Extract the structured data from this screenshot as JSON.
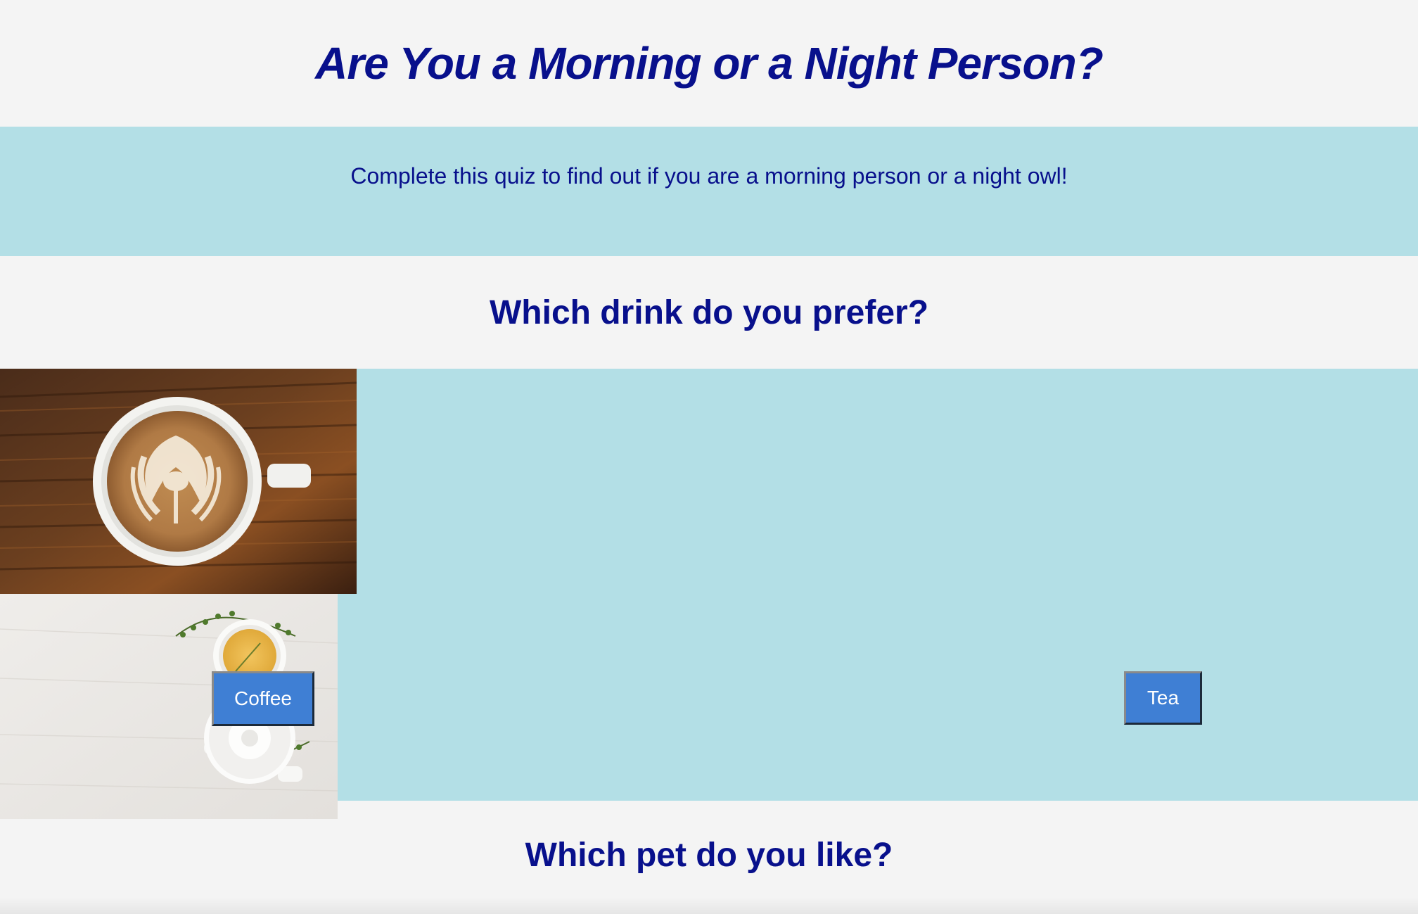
{
  "header": {
    "title": "Are You a Morning or a Night Person?"
  },
  "intro": {
    "text": "Complete this quiz to find out if you are a morning person or a night owl!"
  },
  "questions": [
    {
      "title": "Which drink do you prefer?",
      "options": [
        {
          "label": "Coffee",
          "image": "latte-art-coffee-cup-photo"
        },
        {
          "label": "Tea",
          "image": "teacup-and-teapot-photo"
        }
      ]
    },
    {
      "title": "Which pet do you like?"
    }
  ],
  "colors": {
    "heading": "#08108c",
    "band": "#b3dfe6",
    "background": "#f4f4f4",
    "button": "#3f7fd4",
    "button_text": "#ffffff"
  }
}
